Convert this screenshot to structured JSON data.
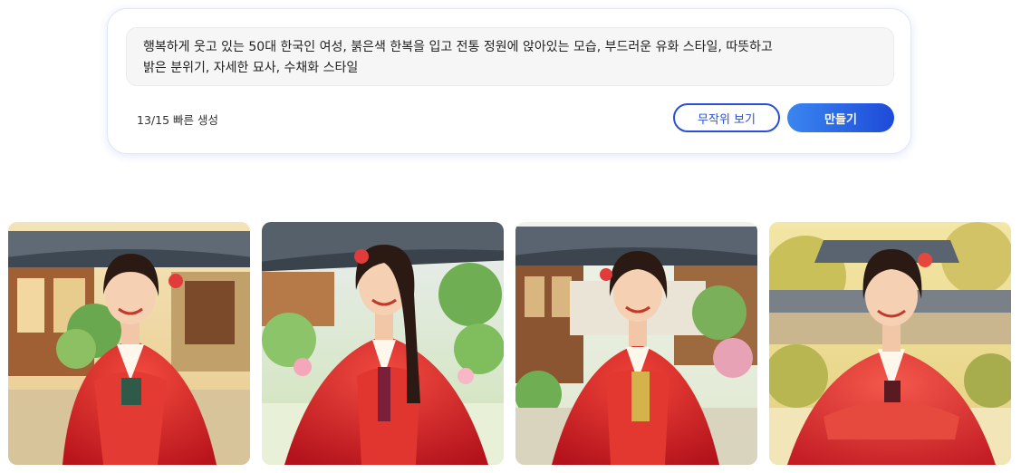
{
  "prompt": {
    "line1": "행복하게 웃고 있는 50대 한국인 여성, 붉은색 한복을 입고 전통 정원에 앉아있는 모습, 부드러운 유화 스타일, 따뜻하고",
    "line2": "밝은 분위기, 자세한 묘사, 수채화 스타일"
  },
  "quota": "13/15 빠른 생성",
  "buttons": {
    "random": "무작위 보기",
    "create": "만들기"
  },
  "colors": {
    "accent_blue": "#2a4fd6",
    "hanbok_red": "#d9262c"
  }
}
